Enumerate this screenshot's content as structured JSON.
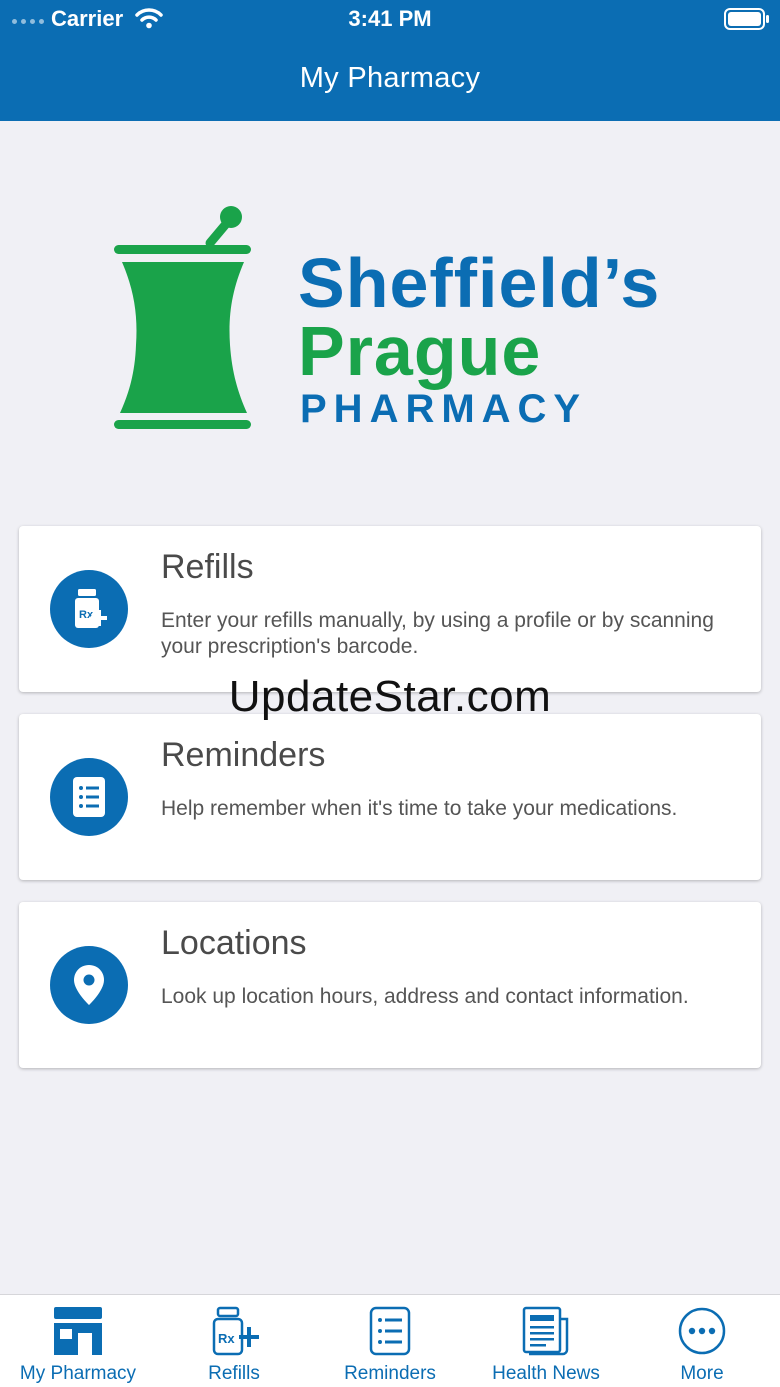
{
  "status_bar": {
    "carrier": "Carrier",
    "time": "3:41 PM"
  },
  "header": {
    "title": "My Pharmacy"
  },
  "logo": {
    "line1": "Sheffield’s",
    "line2": "Prague",
    "line3": "PHARMACY"
  },
  "cards": [
    {
      "title": "Refills",
      "description": "Enter your refills manually, by using a profile or by scanning your prescription's barcode.",
      "icon": "rx-bottle-icon"
    },
    {
      "title": "Reminders",
      "description": "Help remember when it's time to take your medications.",
      "icon": "list-icon"
    },
    {
      "title": "Locations",
      "description": "Look up location hours, address and contact information.",
      "icon": "location-pin-icon"
    }
  ],
  "watermark": "UpdateStar.com",
  "tabbar": {
    "items": [
      {
        "label": "My Pharmacy",
        "icon": "store-icon"
      },
      {
        "label": "Refills",
        "icon": "rx-bottle-icon"
      },
      {
        "label": "Reminders",
        "icon": "list-icon"
      },
      {
        "label": "Health News",
        "icon": "newspaper-icon"
      },
      {
        "label": "More",
        "icon": "more-icon"
      }
    ]
  },
  "colors": {
    "primary": "#0b6db3",
    "brand_green": "#1aa34a",
    "background": "#f0f0f5"
  }
}
